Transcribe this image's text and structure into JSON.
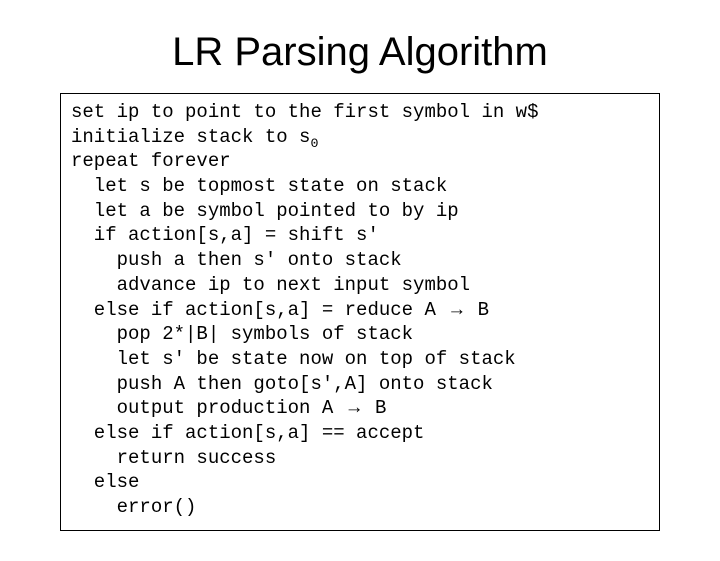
{
  "title": "LR Parsing Algorithm",
  "lines": {
    "l1": "set ip to point to the first symbol in w$",
    "l2a": "initialize stack to s",
    "l2b_sub": "0",
    "l3": "repeat forever",
    "l4": "  let s be topmost state on stack",
    "l5": "  let a be symbol pointed to by ip",
    "l6": "  if action[s,a] = shift s'",
    "l7": "    push a then s' onto stack",
    "l8": "    advance ip to next input symbol",
    "l9a": "  else if action[s,a] = reduce A ",
    "l9_arrow": "→",
    "l9b": " B",
    "l10": "    pop 2*|B| symbols of stack",
    "l11": "    let s' be state now on top of stack",
    "l12": "    push A then goto[s',A] onto stack",
    "l13a": "    output production A ",
    "l13_arrow": "→",
    "l13b": " B",
    "l14": "  else if action[s,a] == accept",
    "l15": "    return success",
    "l16": "  else",
    "l17": "    error()"
  }
}
